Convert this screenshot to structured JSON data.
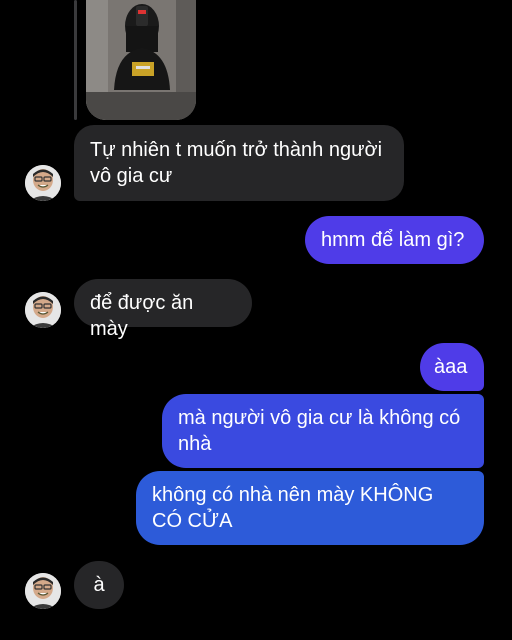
{
  "contact": {
    "avatar_icon": "person-avatar-icon",
    "shared_photo_icon": "mirror-selfie-photo"
  },
  "messages": [
    {
      "id": "m1",
      "from": "them",
      "text": "Tự nhiên t muốn trở thành người vô gia cư"
    },
    {
      "id": "m2",
      "from": "me",
      "text": "hmm để làm gì?"
    },
    {
      "id": "m3",
      "from": "them",
      "text": "để được ăn mày"
    },
    {
      "id": "m4",
      "from": "me",
      "text": "àaa"
    },
    {
      "id": "m5",
      "from": "me",
      "text": "mà người vô gia cư là không có nhà"
    },
    {
      "id": "m6",
      "from": "me",
      "text": "không có nhà nên mày KHÔNG CÓ CỬA"
    },
    {
      "id": "m7",
      "from": "them",
      "text": "à"
    }
  ],
  "colors": {
    "background": "#000000",
    "incoming_bubble": "#262628",
    "outgoing_bubble_purple": "#4f3ce8",
    "outgoing_bubble_blue": "#2d5bd9",
    "text": "#ffffff"
  }
}
